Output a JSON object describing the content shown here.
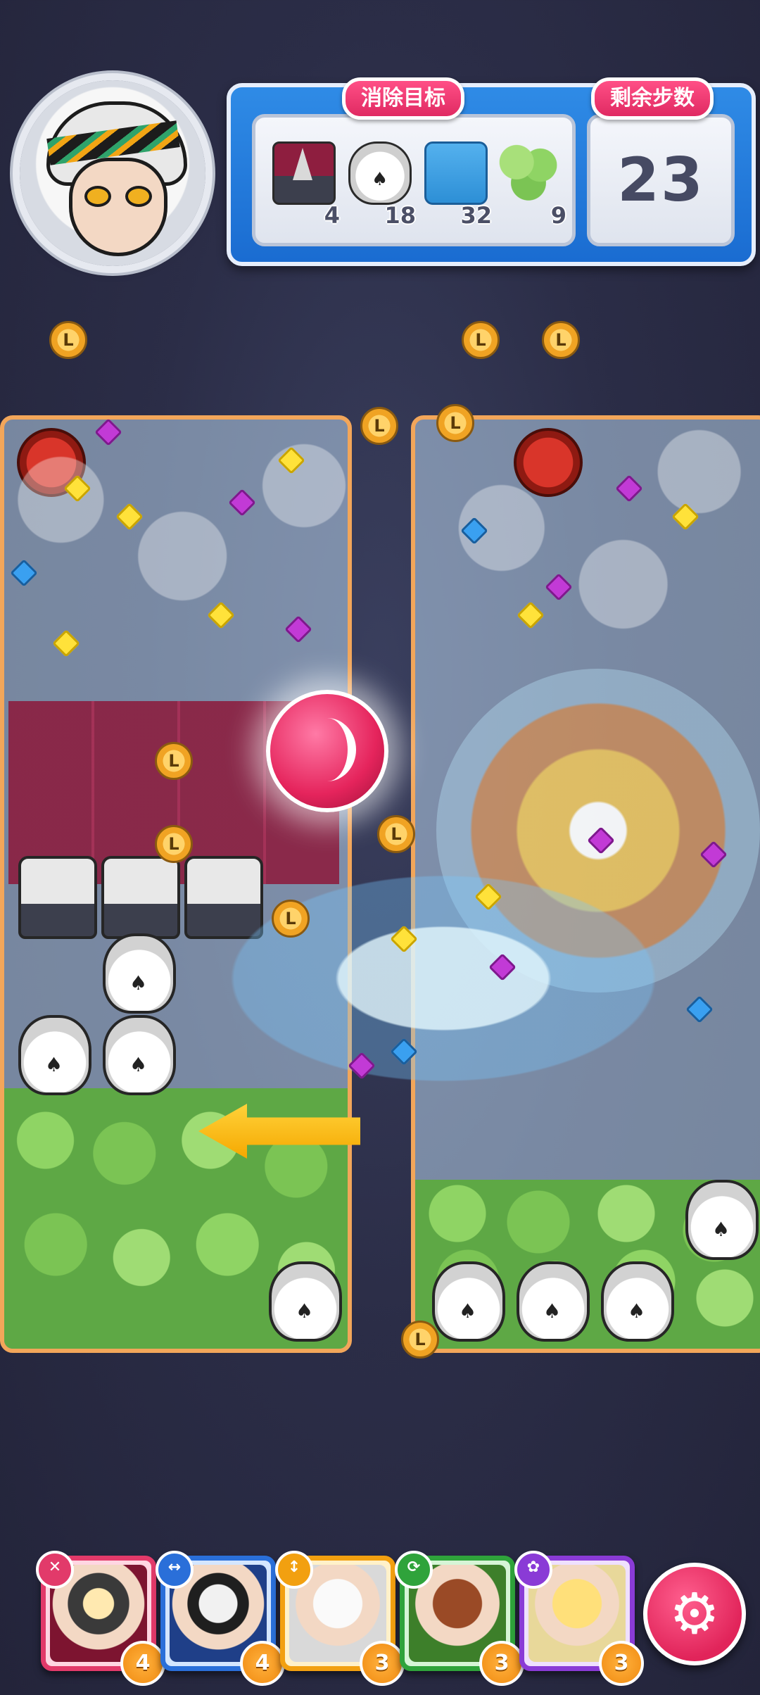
{
  "hud": {
    "goal_title": "消除目标",
    "moves_title": "剩余步数",
    "moves_left": "23",
    "goals": [
      {
        "icon": "drill-block-icon",
        "count": "4"
      },
      {
        "icon": "skull-vase-icon",
        "count": "18"
      },
      {
        "icon": "ice-tile-icon",
        "count": "32"
      },
      {
        "icon": "leaf-tile-icon",
        "count": "9"
      }
    ]
  },
  "board": {
    "coin_label": "L"
  },
  "heroes": [
    {
      "name": "hero-1",
      "skill_icon": "✕",
      "level": "4",
      "color": "#e23a6a"
    },
    {
      "name": "hero-2",
      "skill_icon": "↔",
      "level": "4",
      "color": "#2a6fd9"
    },
    {
      "name": "hero-3",
      "skill_icon": "↕",
      "level": "3",
      "color": "#f2a010"
    },
    {
      "name": "hero-4",
      "skill_icon": "⟳",
      "level": "3",
      "color": "#2fa33b"
    },
    {
      "name": "hero-5",
      "skill_icon": "✿",
      "level": "3",
      "color": "#8a3bd6"
    }
  ],
  "settings_icon": "⚙"
}
